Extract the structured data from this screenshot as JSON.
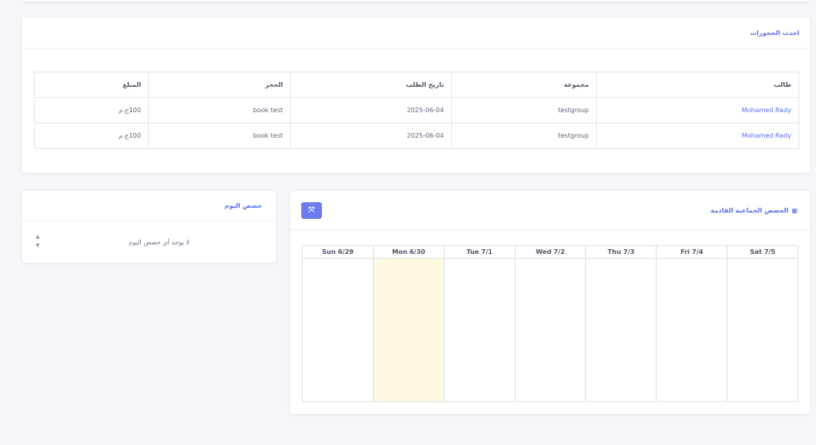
{
  "bookings": {
    "title": "احدث الحجوزات",
    "headers": [
      "طالب",
      "مجموعة",
      "تاريخ الطلب",
      "الحجز",
      "المبلغ"
    ],
    "rows": [
      {
        "student": "Mohamed Rady",
        "group": "testgroup",
        "date": "2025-06-04",
        "booking": "book test",
        "amount": "100ج.م"
      },
      {
        "student": "Mohamed Rady",
        "group": "testgroup",
        "date": "2025-06-04",
        "booking": "book test",
        "amount": "100ج.م"
      }
    ]
  },
  "today_sessions": {
    "title": "حصص اليوم",
    "empty_text": "لا يوجد أي حصص اليوم",
    "sort_up_icon": "▲",
    "sort_down_icon": "▼"
  },
  "schedule": {
    "title": "الحصص الجماعية القادمة",
    "calendar_icon": "calendar-icon",
    "calendar_glyph": "▦",
    "expand_icon": "expand-icon",
    "expand_glyph": "⤧",
    "days": [
      "Sun 6/29",
      "Mon 6/30",
      "Tue 7/1",
      "Wed 7/2",
      "Thu 7/3",
      "Fri 7/4",
      "Sat 7/5"
    ],
    "today_index": 1,
    "today_color": "#fef9e1"
  },
  "colors": {
    "accent": "#5b6dea",
    "button": "#6b7cf0",
    "background": "#f5f6fa"
  }
}
